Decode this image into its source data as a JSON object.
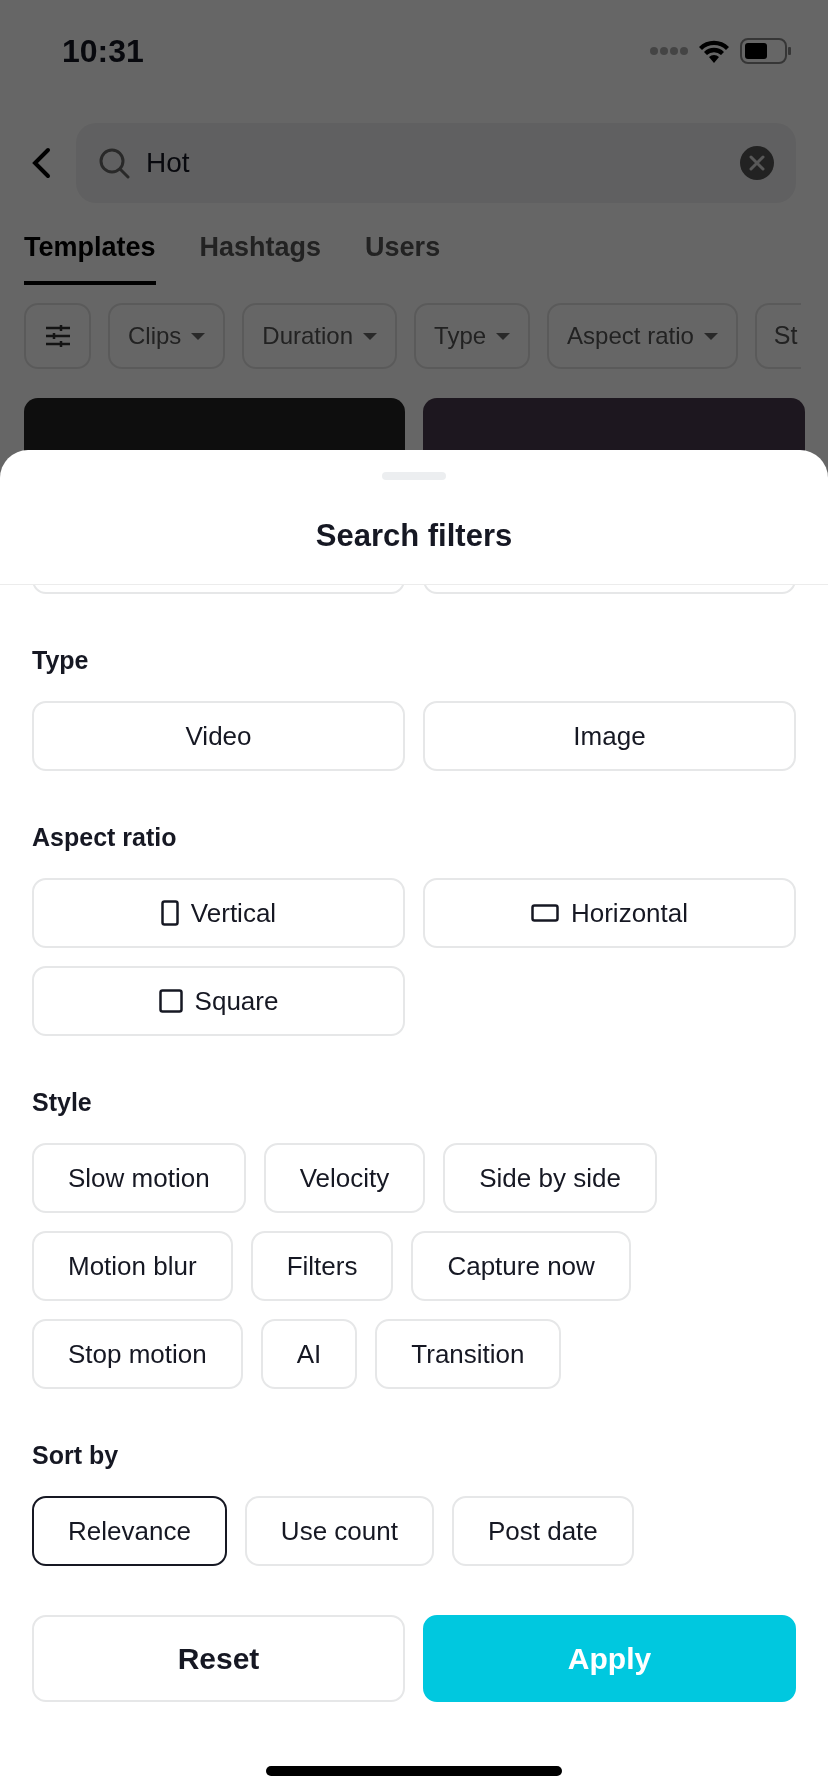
{
  "status_bar": {
    "time": "10:31"
  },
  "search": {
    "value": "Hot"
  },
  "tabs": [
    {
      "label": "Templates",
      "selected": true
    },
    {
      "label": "Hashtags",
      "selected": false
    },
    {
      "label": "Users",
      "selected": false
    }
  ],
  "filter_chips": [
    {
      "label": "Clips"
    },
    {
      "label": "Duration"
    },
    {
      "label": "Type"
    },
    {
      "label": "Aspect ratio"
    },
    {
      "label": "St"
    }
  ],
  "sheet": {
    "title": "Search filters",
    "sections": [
      {
        "title": "Type",
        "kind": "grid",
        "options": [
          {
            "label": "Video",
            "selected": false
          },
          {
            "label": "Image",
            "selected": false
          }
        ]
      },
      {
        "title": "Aspect ratio",
        "kind": "grid",
        "options": [
          {
            "label": "Vertical",
            "kind": "vertical",
            "selected": false
          },
          {
            "label": "Horizontal",
            "kind": "horizontal",
            "selected": false
          },
          {
            "label": "Square",
            "kind": "square",
            "selected": false
          }
        ]
      },
      {
        "title": "Style",
        "kind": "wrap",
        "options": [
          {
            "label": "Slow motion",
            "selected": false
          },
          {
            "label": "Velocity",
            "selected": false
          },
          {
            "label": "Side by side",
            "selected": false
          },
          {
            "label": "Motion blur",
            "selected": false
          },
          {
            "label": "Filters",
            "selected": false
          },
          {
            "label": "Capture now",
            "selected": false
          },
          {
            "label": "Stop motion",
            "selected": false
          },
          {
            "label": "AI",
            "selected": false
          },
          {
            "label": "Transition",
            "selected": false
          }
        ]
      },
      {
        "title": "Sort by",
        "kind": "wrap",
        "options": [
          {
            "label": "Relevance",
            "selected": true
          },
          {
            "label": "Use count",
            "selected": false
          },
          {
            "label": "Post date",
            "selected": false
          }
        ]
      }
    ],
    "buttons": [
      {
        "label": "Reset",
        "kind": "secondary"
      },
      {
        "label": "Apply",
        "kind": "primary"
      }
    ]
  }
}
